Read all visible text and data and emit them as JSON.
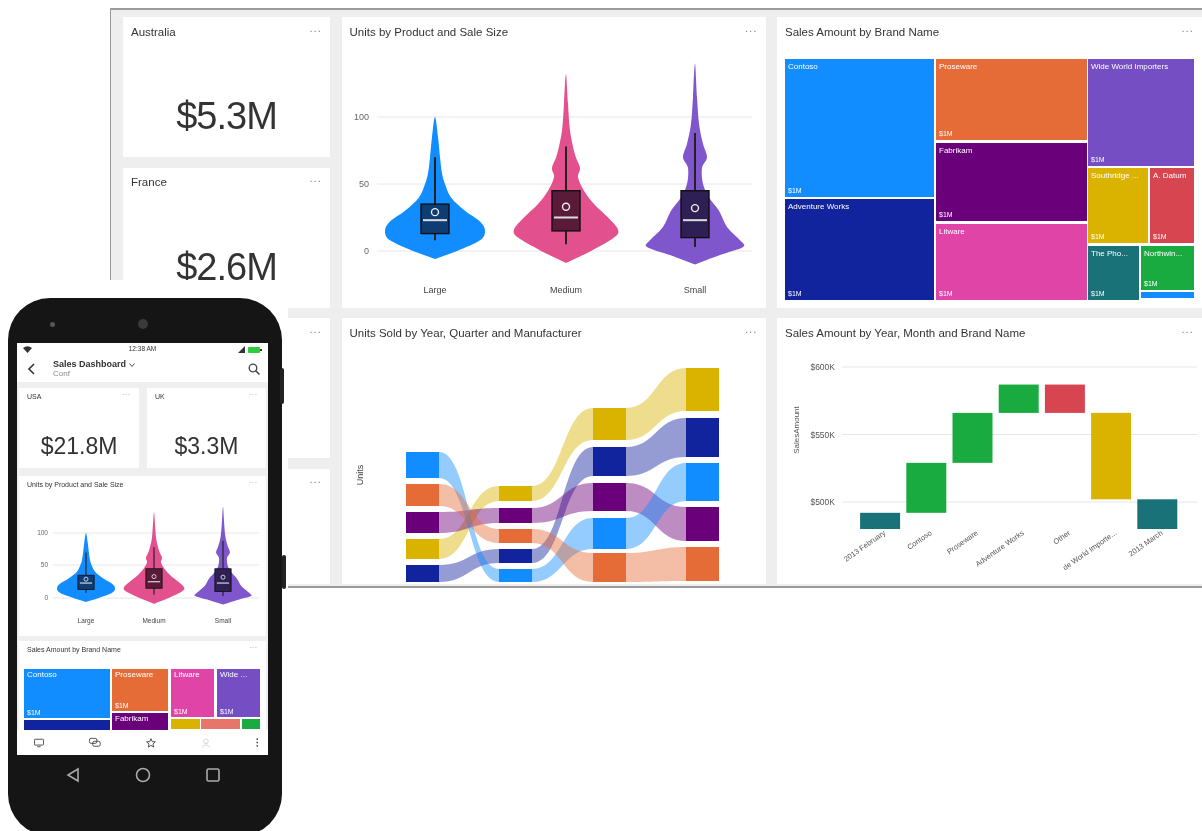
{
  "dashboard": {
    "cards": [
      {
        "title": "Australia",
        "value": "$5.3M",
        "menu": "..."
      },
      {
        "title": "France",
        "value": "$2.6M",
        "menu": "..."
      },
      {
        "menu": "..."
      },
      {
        "menu": "..."
      }
    ],
    "violin": {
      "title": "Units by Product and Sale Size",
      "menu": "...",
      "y_ticks": [
        "100",
        "50",
        "0"
      ],
      "categories": [
        "Large",
        "Medium",
        "Small"
      ]
    },
    "treemap": {
      "title": "Sales Amount by Brand Name",
      "menu": "...",
      "tiles": [
        {
          "label": "Contoso",
          "amount": "$1M",
          "color": "#118dff"
        },
        {
          "label": "Adventure Works",
          "amount": "$1M",
          "color": "#12239e"
        },
        {
          "label": "Proseware",
          "amount": "$1M",
          "color": "#e66c37"
        },
        {
          "label": "Fabrikam",
          "amount": "$1M",
          "color": "#6b007b"
        },
        {
          "label": "Litware",
          "amount": "$1M",
          "color": "#e044a7"
        },
        {
          "label": "Wide World Importers",
          "amount": "$1M",
          "color": "#744ec2"
        },
        {
          "label": "Southridge ...",
          "amount": "$1M",
          "color": "#d9b300"
        },
        {
          "label": "A. Datum",
          "amount": "$1M",
          "color": "#d64550"
        },
        {
          "label": "The Pho...",
          "amount": "$1M",
          "color": "#197278"
        },
        {
          "label": "Northwin...",
          "amount": "$1M",
          "color": "#1aab40"
        },
        {
          "color": "#118dff"
        }
      ]
    },
    "sankey": {
      "title": "Units Sold by Year, Quarter and Manufacturer",
      "menu": "...",
      "ylabel": "Units"
    },
    "waterfall": {
      "title": "Sales Amount by Year, Month and Brand Name",
      "menu": "...",
      "ylabel": "SalesAmount",
      "y_ticks": [
        "$600K",
        "$550K",
        "$500K"
      ],
      "bars": [
        {
          "label": "2013 February",
          "color": "#197278"
        },
        {
          "label": "Contoso",
          "color": "#1aab40"
        },
        {
          "label": "Proseware",
          "color": "#1aab40"
        },
        {
          "label": "Adventure Works",
          "color": "#1aab40"
        },
        {
          "label": "Other",
          "color": "#d64550"
        },
        {
          "label": "de World Importe...",
          "color": "#d9b300"
        },
        {
          "label": "2013 March",
          "color": "#197278"
        }
      ]
    }
  },
  "phone": {
    "status_bar": {
      "time": "12:38 AM"
    },
    "header": {
      "title": "Sales Dashboard",
      "subtitle": "Conf"
    },
    "cards": [
      {
        "title": "USA",
        "value": "$21.8M",
        "menu": "..."
      },
      {
        "title": "UK",
        "value": "$3.3M",
        "menu": "..."
      }
    ],
    "violin": {
      "title": "Units by Product and Sale Size",
      "menu": "...",
      "y_ticks": [
        "100",
        "50",
        "0"
      ],
      "categories": [
        "Large",
        "Medium",
        "Small"
      ]
    },
    "treemap": {
      "title": "Sales Amount by Brand Name",
      "menu": "...",
      "tiles": [
        {
          "label": "Contoso",
          "amount": "$1M",
          "color": "#118dff"
        },
        {
          "label": "Proseware",
          "amount": "$1M",
          "color": "#e66c37"
        },
        {
          "label": "Litware",
          "amount": "$1M",
          "color": "#e044a7"
        },
        {
          "label": "Wide ...",
          "amount": "$1M",
          "color": "#744ec2"
        },
        {
          "label": "Fabrikam",
          "color": "#6b007b"
        },
        {
          "color": "#12239e"
        },
        {
          "color": "#d9b300"
        },
        {
          "color": "#e8756a"
        },
        {
          "color": "#1aab40"
        }
      ]
    }
  }
}
